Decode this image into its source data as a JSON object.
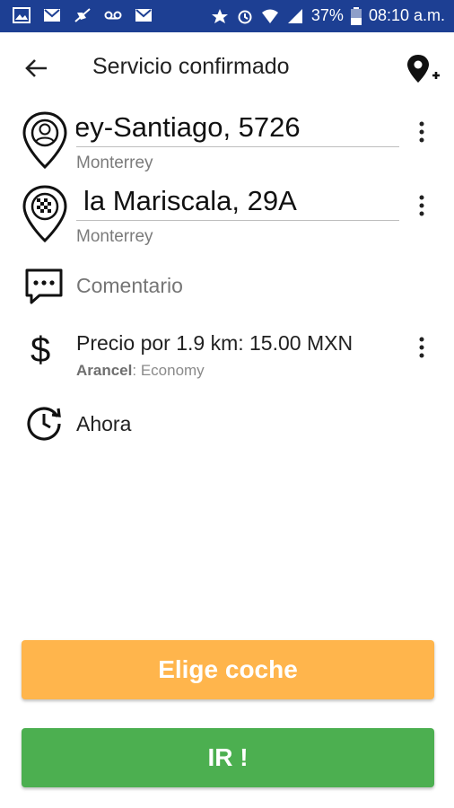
{
  "statusbar": {
    "battery": "37%",
    "time": "08:10 a.m."
  },
  "toolbar": {
    "title": "Servicio confirmado"
  },
  "origin": {
    "address": "ey-Santiago, 5726",
    "city": "Monterrey"
  },
  "destination": {
    "address": "la Mariscala, 29A",
    "city": "Monterrey"
  },
  "comment": {
    "placeholder": "Comentario"
  },
  "price": {
    "text": "Precio por 1.9 km: 15.00 MXN",
    "tariff_label": "Arancel",
    "tariff_value": ": Economy"
  },
  "time": {
    "text": "Ahora"
  },
  "buttons": {
    "choose_car": "Elige coche",
    "go": "IR !"
  },
  "colors": {
    "statusbar": "#1d3f93",
    "choose_car": "#ffb54c",
    "go": "#4caf50"
  }
}
